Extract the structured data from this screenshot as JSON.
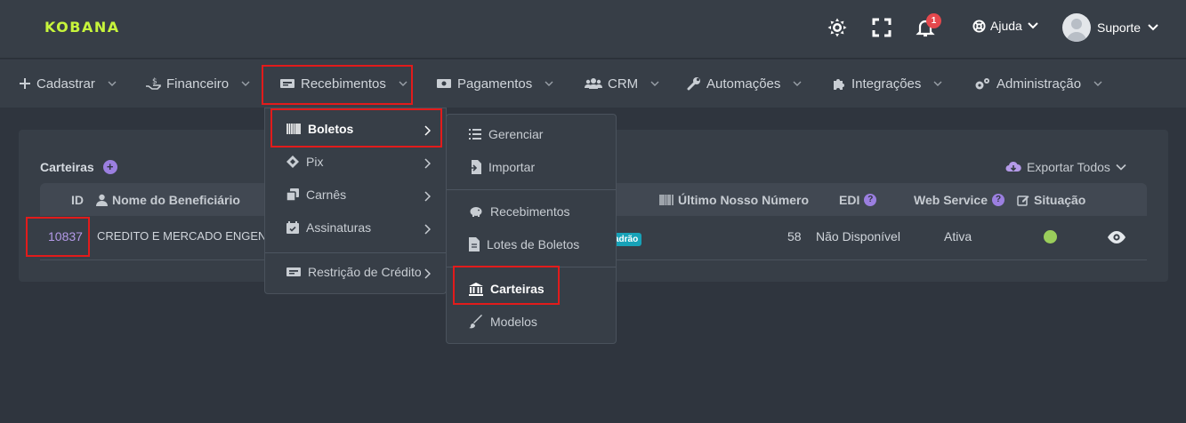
{
  "brand": {
    "logo_text": "KOBANA",
    "accent": "#c7f53b"
  },
  "header": {
    "icons": [
      "theme-toggle-icon",
      "fullscreen-icon",
      "bell-icon"
    ],
    "notification_count": "1",
    "help_label": "Ajuda",
    "user_label": "Suporte"
  },
  "nav": {
    "items": [
      {
        "label": "Cadastrar",
        "icon": "plus-icon"
      },
      {
        "label": "Financeiro",
        "icon": "hand-dollar-icon"
      },
      {
        "label": "Recebimentos",
        "icon": "money-card-icon"
      },
      {
        "label": "Pagamentos",
        "icon": "money-bill-icon"
      },
      {
        "label": "CRM",
        "icon": "users-icon"
      },
      {
        "label": "Automações",
        "icon": "wrench-icon"
      },
      {
        "label": "Integrações",
        "icon": "puzzle-icon"
      },
      {
        "label": "Administração",
        "icon": "cogs-icon"
      }
    ]
  },
  "menu_recebimentos": {
    "items": [
      {
        "label": "Boletos",
        "icon": "barcode-icon"
      },
      {
        "label": "Pix",
        "icon": "pix-icon"
      },
      {
        "label": "Carnês",
        "icon": "copy-icon"
      },
      {
        "label": "Assinaturas",
        "icon": "calendar-check-icon"
      },
      {
        "label": "Restrição de Crédito",
        "icon": "money-card-icon"
      }
    ]
  },
  "menu_boletos": {
    "items": [
      {
        "label": "Gerenciar",
        "icon": "list-icon"
      },
      {
        "label": "Importar",
        "icon": "file-import-icon"
      },
      {
        "label": "Recebimentos",
        "icon": "piggy-bank-icon"
      },
      {
        "label": "Lotes de Boletos",
        "icon": "file-icon"
      },
      {
        "label": "Carteiras",
        "icon": "bank-icon"
      },
      {
        "label": "Modelos",
        "icon": "brush-icon"
      }
    ]
  },
  "page": {
    "title": "Carteiras",
    "export_label": "Exportar Todos"
  },
  "table": {
    "headers": {
      "id": "ID",
      "beneficiario": "Nome do Beneficiário",
      "ultimo_nosso_numero": "Último Nosso Número",
      "edi": "EDI",
      "web_service": "Web Service",
      "situacao": "Situação"
    },
    "rows": [
      {
        "id": "10837",
        "beneficiario": "CREDITO E MERCADO ENGEN",
        "tag": "adrão",
        "ultimo_nosso_numero": "58",
        "edi": "Não Disponível",
        "web_service": "Ativa",
        "status_color": "#9acd5b"
      }
    ]
  }
}
